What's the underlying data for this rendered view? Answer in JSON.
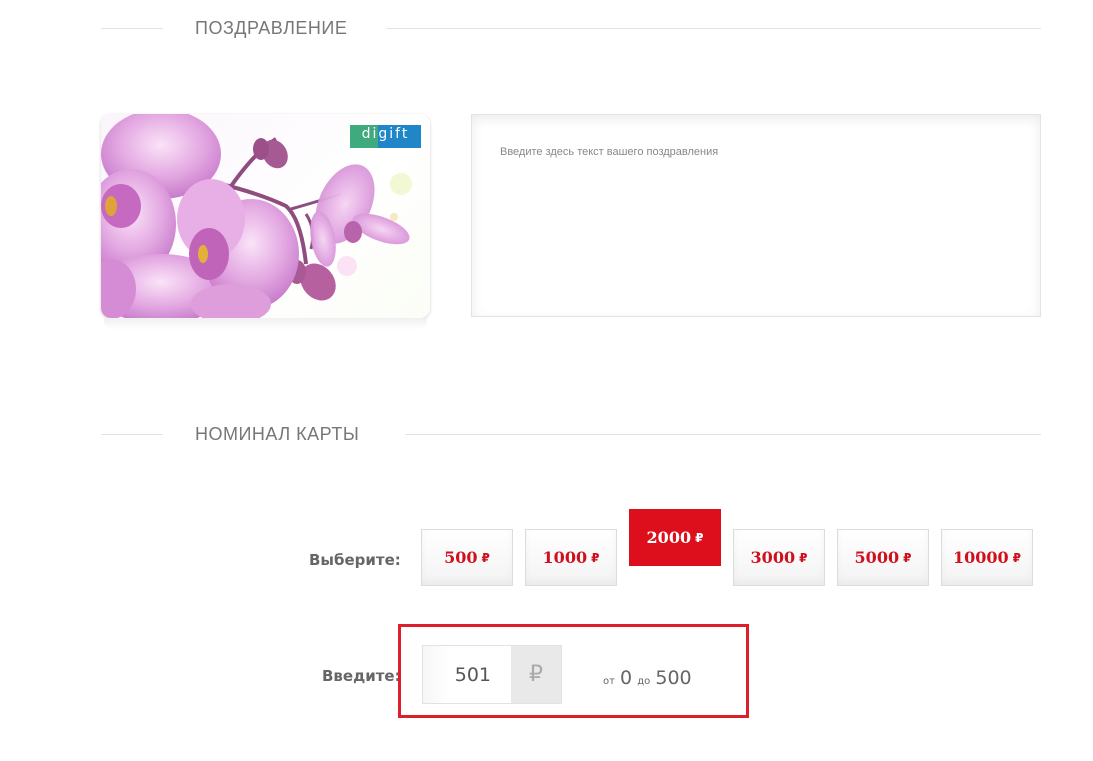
{
  "sections": {
    "greeting_title": "ПОЗДРАВЛЕНИЕ",
    "denomination_title": "НОМИНАЛ КАРТЫ"
  },
  "card": {
    "brand": "digift",
    "image": "orchid-flowers",
    "colors": {
      "petal": "#d98fd7",
      "brand_green": "#3faa7e",
      "brand_blue": "#1f86c8"
    }
  },
  "message": {
    "placeholder": "Введите здесь текст вашего поздравления",
    "value": ""
  },
  "denomination": {
    "choose_label": "Выберите:",
    "currency_symbol": "₽",
    "options": [
      {
        "value": "500",
        "selected": false
      },
      {
        "value": "1000",
        "selected": false
      },
      {
        "value": "2000",
        "selected": true
      },
      {
        "value": "3000",
        "selected": false
      },
      {
        "value": "5000",
        "selected": false
      },
      {
        "value": "10000",
        "selected": false
      }
    ],
    "enter_label": "Введите:",
    "custom_value": "501",
    "range": {
      "from_label": "от",
      "min": "0",
      "to_label": "до",
      "max": "500"
    }
  },
  "colors": {
    "accent": "#de0f1c",
    "highlight_border": "#dd1f2c"
  }
}
